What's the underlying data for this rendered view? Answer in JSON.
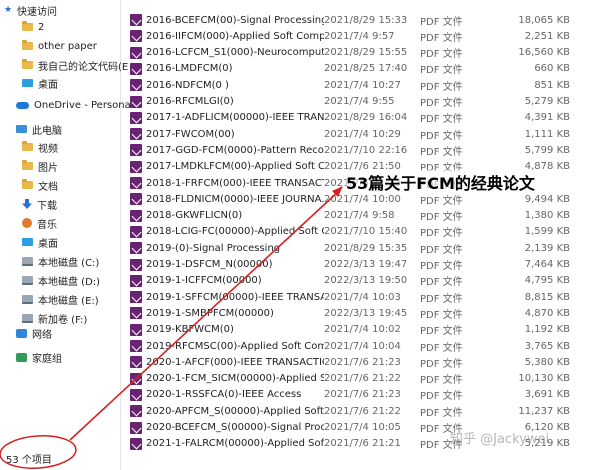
{
  "nav": {
    "quick_access": "快速访问",
    "items": [
      {
        "label": "2",
        "icon": "folder-icon",
        "type": "folder"
      },
      {
        "label": "other paper",
        "icon": "folder-icon",
        "type": "folder"
      },
      {
        "label": "我自己的论文代码(E",
        "icon": "folder-icon",
        "type": "folder"
      },
      {
        "label": "桌面",
        "icon": "desktop-icon",
        "type": "desk"
      }
    ],
    "onedrive": "OneDrive - Persona",
    "this_pc": "此电脑",
    "pc_items": [
      {
        "label": "视频",
        "icon": "video-folder-icon",
        "type": "folder"
      },
      {
        "label": "图片",
        "icon": "pictures-folder-icon",
        "type": "folder"
      },
      {
        "label": "文档",
        "icon": "documents-folder-icon",
        "type": "folder"
      },
      {
        "label": "下载",
        "icon": "download-icon",
        "type": "down"
      },
      {
        "label": "音乐",
        "icon": "music-icon",
        "type": "music"
      },
      {
        "label": "桌面",
        "icon": "desktop-icon",
        "type": "desk"
      },
      {
        "label": "本地磁盘 (C:)",
        "icon": "drive-icon",
        "type": "drive"
      },
      {
        "label": "本地磁盘 (D:)",
        "icon": "drive-icon",
        "type": "drive"
      },
      {
        "label": "本地磁盘 (E:)",
        "icon": "drive-icon",
        "type": "drive"
      },
      {
        "label": "新加卷 (F:)",
        "icon": "drive-icon",
        "type": "drive"
      }
    ],
    "network": "网络",
    "homegroup": "家庭组"
  },
  "status": "53 个项目",
  "annotation": "53篇关于FCM的经典论文",
  "watermark": "知乎 @Jackywei",
  "files": [
    {
      "name": "2016-BCEFCM(00)-Signal Processing",
      "date": "2021/8/29 15:33",
      "type": "PDF 文件",
      "size": "18,065 KB"
    },
    {
      "name": "2016-IIFCM(000)-Applied Soft Comp...",
      "date": "2021/7/4 9:57",
      "type": "PDF 文件",
      "size": "2,251 KB"
    },
    {
      "name": "2016-LCFCM_S1(000)-Neurocomputi...",
      "date": "2021/8/29 15:55",
      "type": "PDF 文件",
      "size": "16,560 KB"
    },
    {
      "name": "2016-LMDFCM(0)",
      "date": "2021/8/25 17:40",
      "type": "PDF 文件",
      "size": "660 KB"
    },
    {
      "name": "2016-NDFCM(0 )",
      "date": "2021/7/4 10:27",
      "type": "PDF 文件",
      "size": "851 KB"
    },
    {
      "name": "2016-RFCMLGI(0)",
      "date": "2021/7/4 9:55",
      "type": "PDF 文件",
      "size": "5,279 KB"
    },
    {
      "name": "2017-1-ADFLICM(00000)-IEEE TRANS...",
      "date": "2021/8/29 16:04",
      "type": "PDF 文件",
      "size": "4,391 KB"
    },
    {
      "name": "2017-FWCOM(00)",
      "date": "2021/7/4 10:29",
      "type": "PDF 文件",
      "size": "1,111 KB"
    },
    {
      "name": "2017-GGD-FCM(0000)-Pattern Recog...",
      "date": "2021/7/10 22:16",
      "type": "PDF 文件",
      "size": "5,799 KB"
    },
    {
      "name": "2017-LMDKLFCM(00)-Applied Soft C...",
      "date": "2021/7/6 21:50",
      "type": "PDF 文件",
      "size": "4,878 KB"
    },
    {
      "name": "2018-1-FRFCM(000)-IEEE TRANSACTI...",
      "date": "2021/7/6 21:23",
      "type": "PDF 文件",
      "size": ""
    },
    {
      "name": "2018-FLDNICM(0000)-IEEE JOURNA...",
      "date": "2021/7/4 10:00",
      "type": "PDF 文件",
      "size": "9,494 KB"
    },
    {
      "name": "2018-GKWFLICN(0)",
      "date": "2021/7/4 9:58",
      "type": "PDF 文件",
      "size": "1,380 KB"
    },
    {
      "name": "2018-LCIG-FC(00000)-Applied Soft C...",
      "date": "2021/7/10 15:40",
      "type": "PDF 文件",
      "size": "1,599 KB"
    },
    {
      "name": "2019-(0)-Signal Processing",
      "date": "2021/8/29 15:35",
      "type": "PDF 文件",
      "size": "2,139 KB"
    },
    {
      "name": "2019-1-DSFCM_N(00000)",
      "date": "2022/3/13 19:47",
      "type": "PDF 文件",
      "size": "7,464 KB"
    },
    {
      "name": "2019-1-ICFFCM(00000)",
      "date": "2022/3/13 19:50",
      "type": "PDF 文件",
      "size": "4,795 KB"
    },
    {
      "name": "2019-1-SFFCM(00000)-IEEE TRANSAC...",
      "date": "2021/7/4 10:03",
      "type": "PDF 文件",
      "size": "8,815 KB"
    },
    {
      "name": "2019-1-SMBPFCM(00000)",
      "date": "2022/3/13 19:45",
      "type": "PDF 文件",
      "size": "4,870 KB"
    },
    {
      "name": "2019-KBFWCM(0)",
      "date": "2021/7/4 10:02",
      "type": "PDF 文件",
      "size": "1,192 KB"
    },
    {
      "name": "2019-RFCMSC(00)-Applied Soft Com...",
      "date": "2021/7/4 10:04",
      "type": "PDF 文件",
      "size": "3,765 KB"
    },
    {
      "name": "2020-1-AFCF(000)-IEEE TRANSACTIO...",
      "date": "2021/7/6 21:23",
      "type": "PDF 文件",
      "size": "5,380 KB"
    },
    {
      "name": "2020-1-FCM_SICM(00000)-Applied S...",
      "date": "2021/7/6 21:22",
      "type": "PDF 文件",
      "size": "10,130 KB"
    },
    {
      "name": "2020-1-RSSFCA(0)-IEEE Access",
      "date": "2021/7/6 21:23",
      "type": "PDF 文件",
      "size": "3,691 KB"
    },
    {
      "name": "2020-APFCM_S(00000)-Applied Soft ...",
      "date": "2021/7/6 21:22",
      "type": "PDF 文件",
      "size": "11,237 KB"
    },
    {
      "name": "2020-BCEFCM_S(00000)-Signal Proce...",
      "date": "2021/7/4 10:05",
      "type": "PDF 文件",
      "size": "6,120 KB"
    },
    {
      "name": "2021-1-FALRCM(00000)-Applied Sof...",
      "date": "2021/7/6 21:21",
      "type": "PDF 文件",
      "size": "5,219 KB"
    }
  ]
}
